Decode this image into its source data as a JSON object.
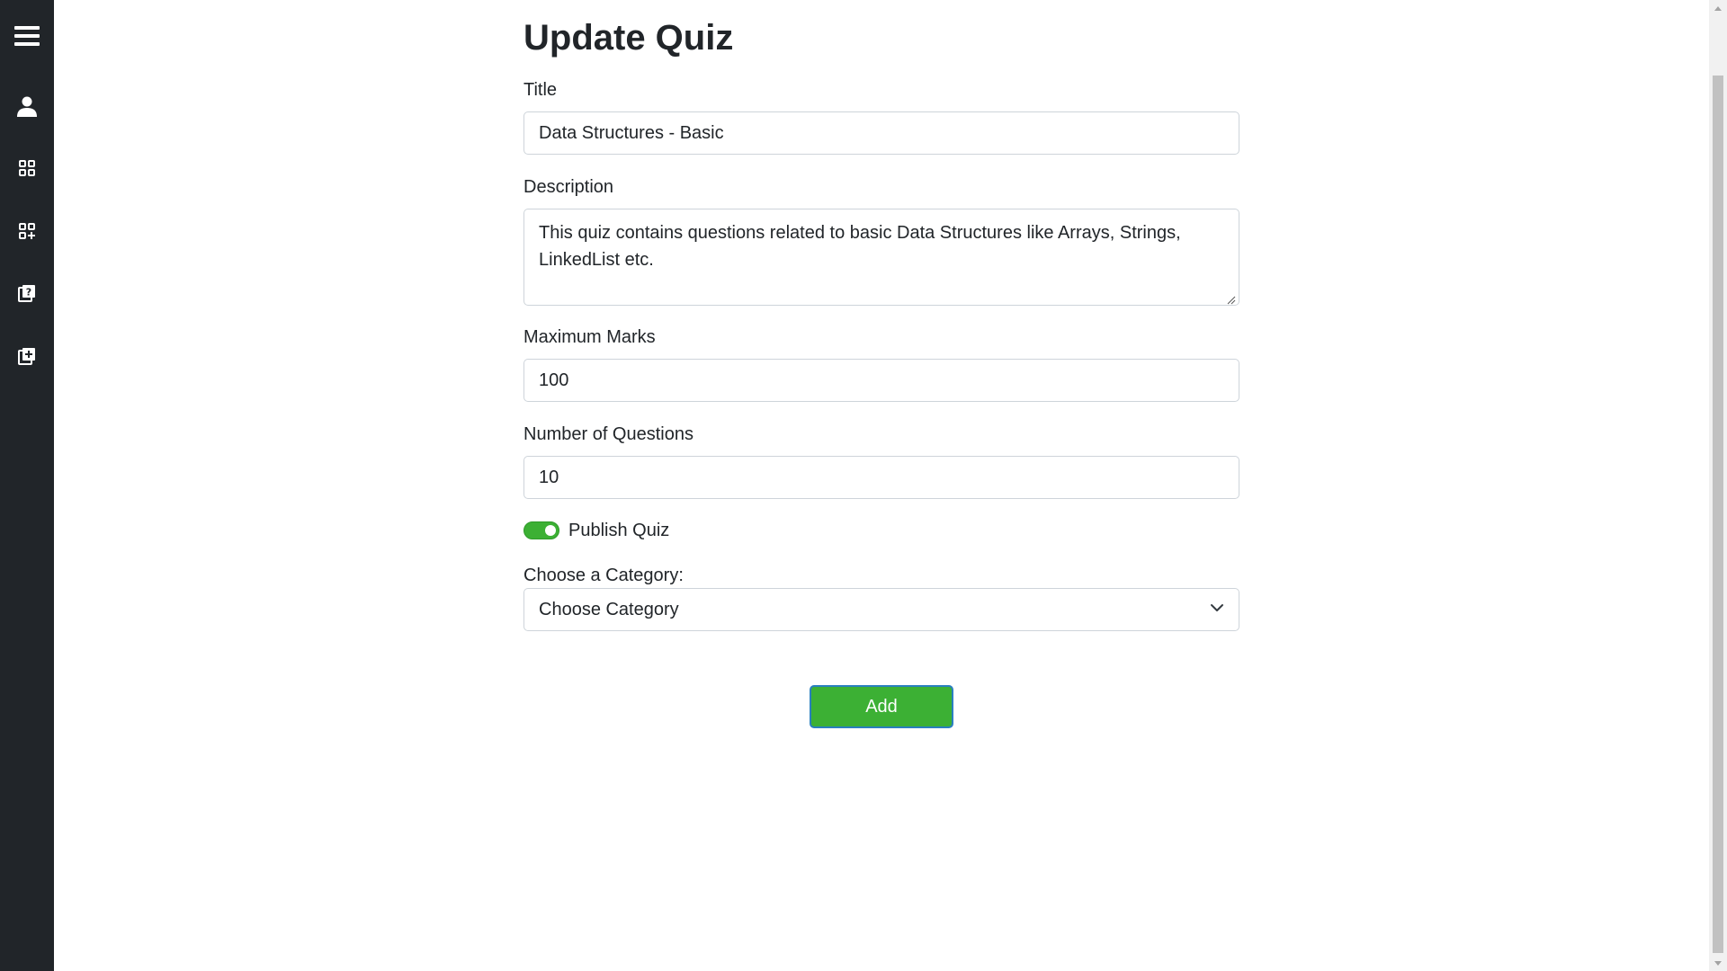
{
  "page": {
    "title": "Update Quiz"
  },
  "sidebar": {
    "items": [
      {
        "icon": "menu-icon"
      },
      {
        "icon": "user-icon"
      },
      {
        "icon": "categories-grid-icon"
      },
      {
        "icon": "add-category-icon"
      },
      {
        "icon": "quiz-icon"
      },
      {
        "icon": "add-quiz-icon"
      }
    ],
    "background": "#212529"
  },
  "form": {
    "title_label": "Title",
    "title_value": "Data Structures - Basic",
    "description_label": "Description",
    "description_value": "This quiz contains questions related to basic Data Structures like Arrays, Strings, LinkedList etc.",
    "max_marks_label": "Maximum Marks",
    "max_marks_value": "100",
    "num_questions_label": "Number of Questions",
    "num_questions_value": "10",
    "publish_label": "Publish Quiz",
    "publish_on": true,
    "category_label": "Choose a Category:",
    "category_selected": "Choose Category",
    "submit_label": "Add"
  },
  "colors": {
    "accent": "#3cb034",
    "button_border": "#2a7fbf",
    "text": "#212529",
    "input_border": "#ced4da"
  }
}
